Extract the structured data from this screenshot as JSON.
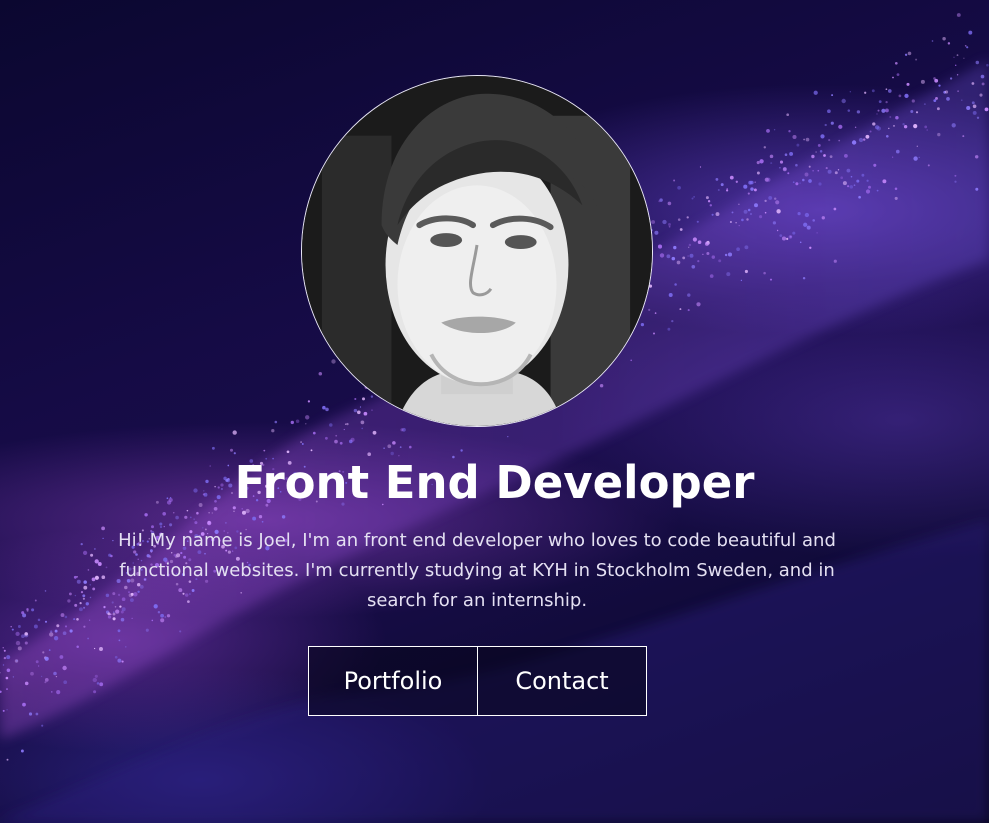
{
  "hero": {
    "title": "Front End Developer",
    "intro": "Hi! My name is Joel, I'm an front end developer who loves to code beautiful and functional websites. I'm currently studying at KYH in Stockholm Sweden, and in search for an internship.",
    "profile_photo": "profile-photo",
    "background": "purple-particle-wave"
  },
  "actions": {
    "portfolio_label": "Portfolio",
    "contact_label": "Contact"
  },
  "colors": {
    "background_dark": "#0b0730",
    "accent_purple": "#a25ae0",
    "text": "#ffffff"
  }
}
